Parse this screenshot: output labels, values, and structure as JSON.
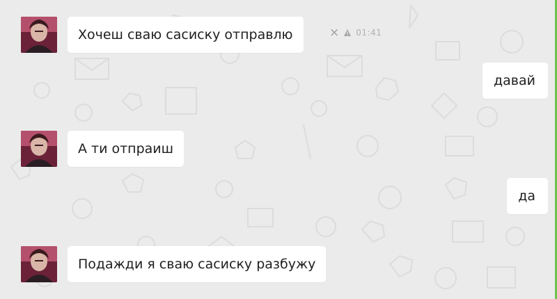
{
  "messages": [
    {
      "direction": "in",
      "text": "Хочеш сваю сасиску отправлю",
      "time": "01:41"
    },
    {
      "direction": "out",
      "text": "давай"
    },
    {
      "direction": "in",
      "text": "А ти отпраиш"
    },
    {
      "direction": "out",
      "text": "да"
    },
    {
      "direction": "in",
      "text": "Подажди я сваю сасиску разбужу"
    }
  ],
  "icons": {
    "message_action_close": "close-icon",
    "message_action_warning": "warning-icon"
  },
  "colors": {
    "chat_background": "#ebebeb",
    "bubble_background": "#ffffff",
    "accent_edge": "#6cc24a",
    "timestamp": "#b0b0b0"
  }
}
